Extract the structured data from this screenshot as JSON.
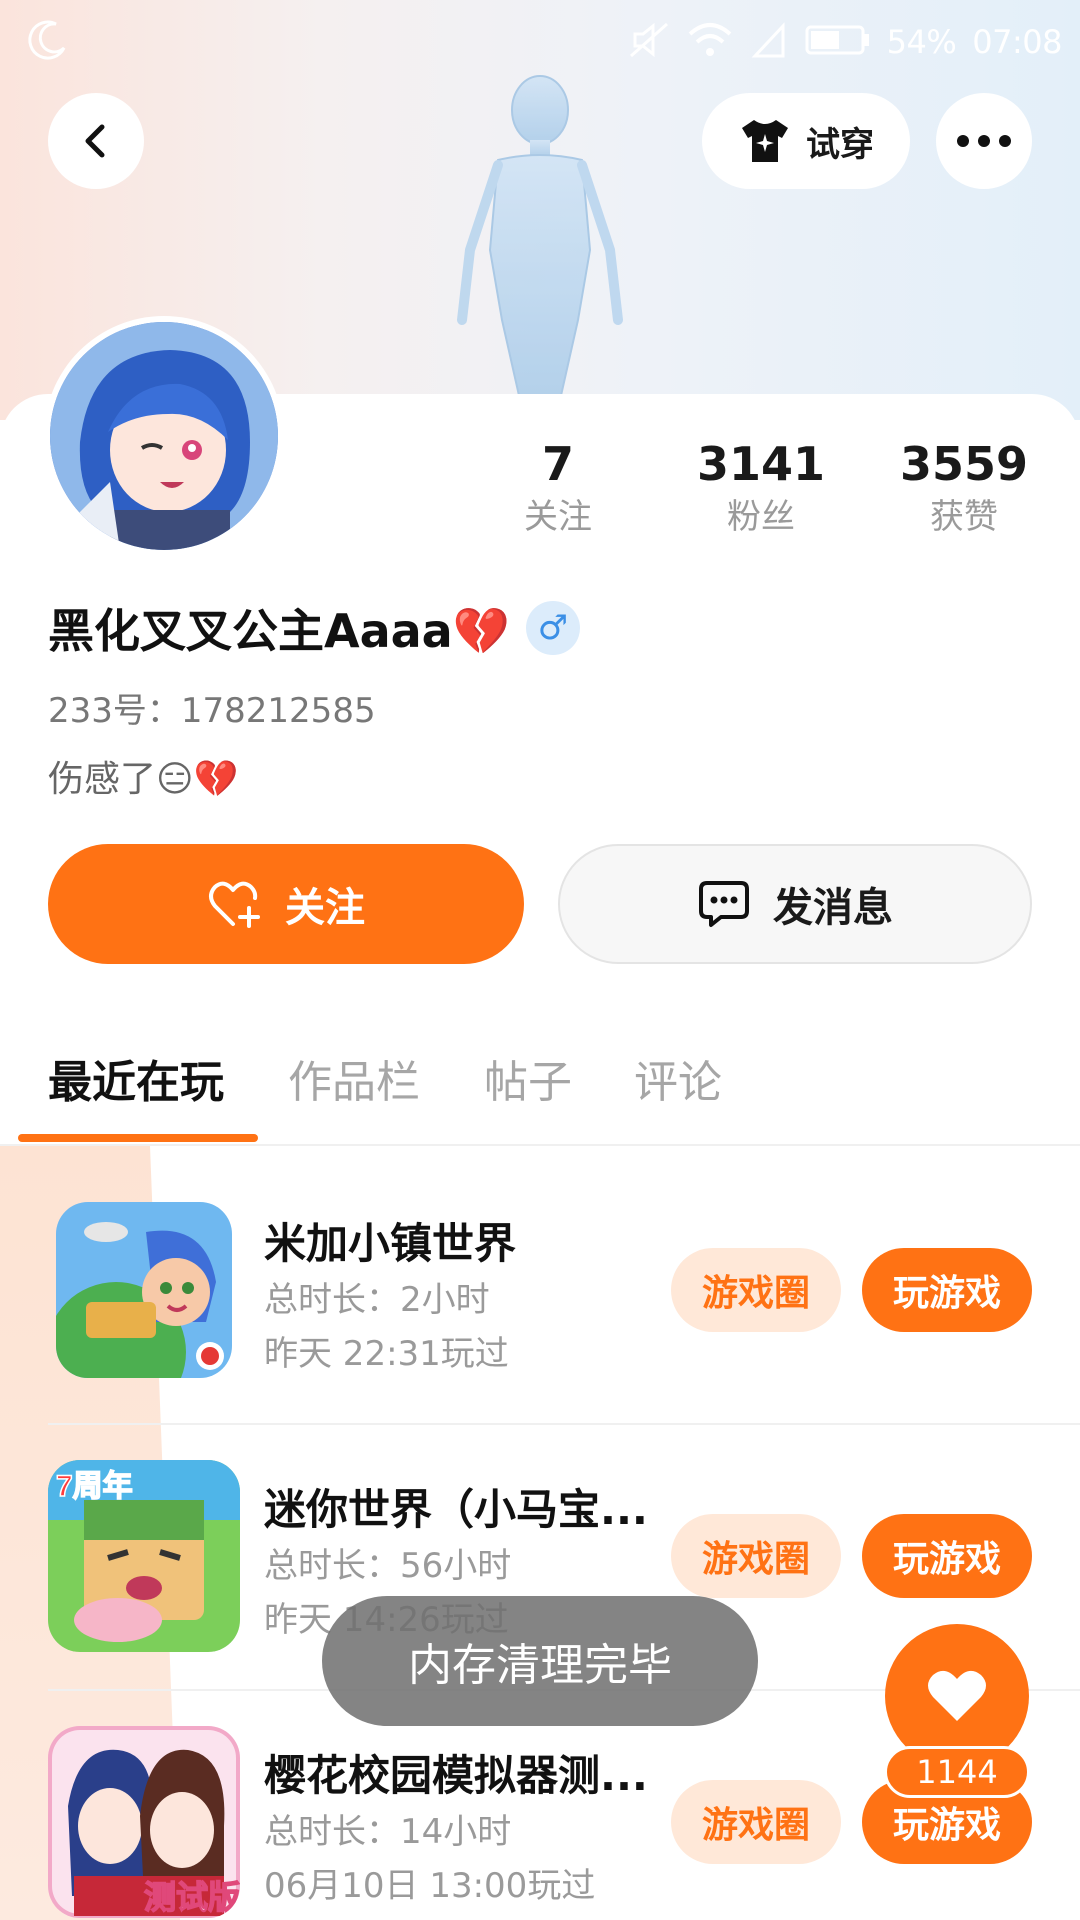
{
  "status_bar": {
    "battery": "54%",
    "time": "07:08"
  },
  "header": {
    "try_on_label": "试穿"
  },
  "profile": {
    "stats": [
      {
        "value": "7",
        "label": "关注"
      },
      {
        "value": "3141",
        "label": "粉丝"
      },
      {
        "value": "3559",
        "label": "获赞"
      }
    ],
    "nickname": "黑化叉叉公主Aaaa💔",
    "gender_symbol": "♂",
    "uid": "233号：178212585",
    "bio": "伤感了😑💔"
  },
  "actions": {
    "follow_label": "关注",
    "message_label": "发消息"
  },
  "tabs": [
    {
      "label": "最近在玩"
    },
    {
      "label": "作品栏"
    },
    {
      "label": "帖子"
    },
    {
      "label": "评论"
    }
  ],
  "games": [
    {
      "name": "米加小镇世界",
      "duration": "总时长：2小时",
      "last_played": "昨天 22:31玩过",
      "circle_label": "游戏圈",
      "play_label": "玩游戏"
    },
    {
      "name": "迷你世界（小马宝...",
      "duration": "总时长：56小时",
      "last_played": "昨天 14:26玩过",
      "icon_badge": "7周年",
      "circle_label": "游戏圈",
      "play_label": "玩游戏"
    },
    {
      "name": "樱花校园模拟器测...",
      "duration": "总时长：14小时",
      "last_played": "06月10日 13:00玩过",
      "icon_badge": "测试版",
      "circle_label": "游戏圈",
      "play_label": "玩游戏"
    }
  ],
  "toast": "内存清理完毕",
  "like_count": "1144",
  "colors": {
    "accent": "#ff7214",
    "accent_light": "#ffe8d8",
    "gender": "#3b8fe6"
  }
}
